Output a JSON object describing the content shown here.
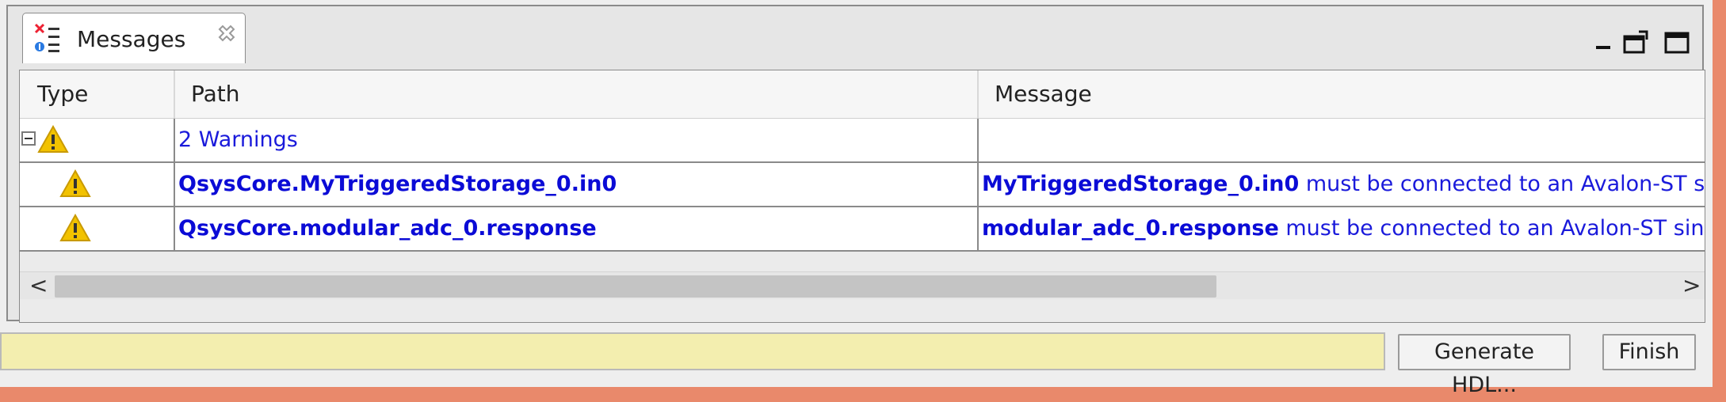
{
  "tab": {
    "title": "Messages"
  },
  "table": {
    "columns": [
      "Type",
      "Path",
      "Message"
    ],
    "group": {
      "label": "2 Warnings"
    },
    "rows": [
      {
        "path": "QsysCore.MyTriggeredStorage_0.in0",
        "message_bold": "MyTriggeredStorage_0.in0",
        "message_rest": " must be connected to an Avalon-ST source"
      },
      {
        "path": "QsysCore.modular_adc_0.response",
        "message_bold": "modular_adc_0.response",
        "message_rest": " must be connected to an Avalon-ST sink"
      }
    ]
  },
  "scrollbar": {
    "left_arrow": "<",
    "right_arrow": ">"
  },
  "buttons": {
    "generate": "Generate HDL...",
    "finish": "Finish"
  },
  "colors": {
    "warning": "#f2c200",
    "link": "#0b0bd6",
    "status_bar": "#f3eeaf",
    "frame": "#e9896b"
  },
  "icons": [
    "messages-icon",
    "close-tab-icon",
    "minimize-icon",
    "detach-icon",
    "maximize-icon",
    "collapse-icon",
    "warning-icon"
  ]
}
